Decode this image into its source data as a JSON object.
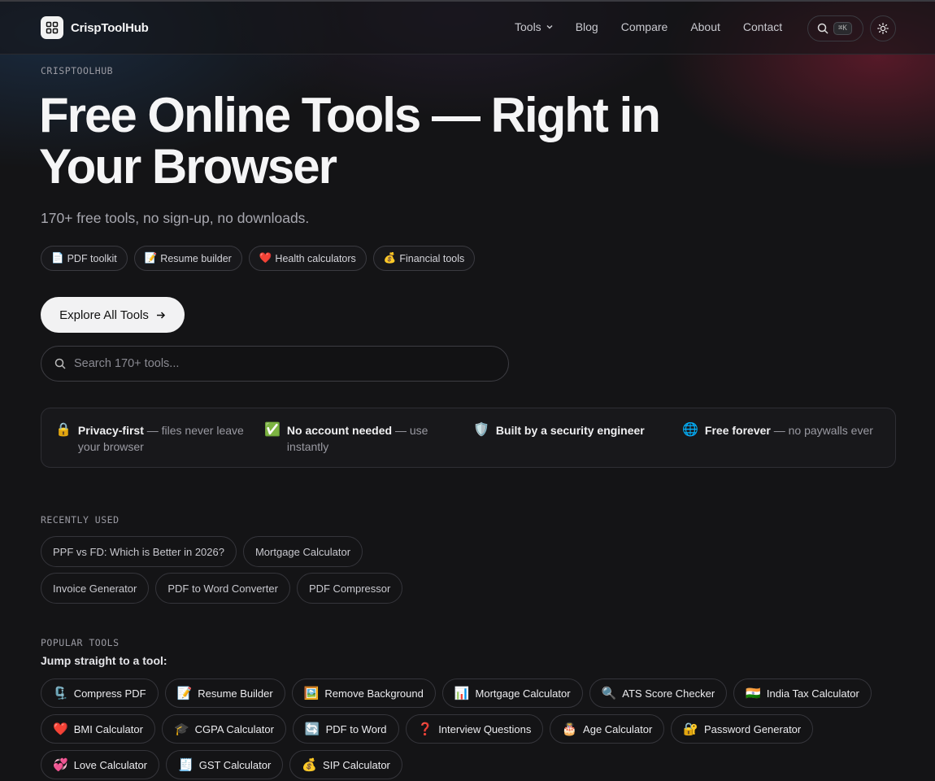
{
  "header": {
    "brand": "CrispToolHub",
    "nav": [
      {
        "label": "Tools",
        "has_dropdown": true
      },
      {
        "label": "Blog"
      },
      {
        "label": "Compare"
      },
      {
        "label": "About"
      },
      {
        "label": "Contact"
      }
    ],
    "search_shortcut": "⌘K"
  },
  "hero": {
    "eyebrow": "CRISPTOOLHUB",
    "title_line1": "Free Online Tools — Right in",
    "title_line2": "Your Browser",
    "subtitle": "170+ free tools, no sign-up, no downloads.",
    "chips": [
      {
        "emoji": "📄",
        "label": "PDF toolkit"
      },
      {
        "emoji": "📝",
        "label": "Resume builder"
      },
      {
        "emoji": "❤️",
        "label": "Health calculators"
      },
      {
        "emoji": "💰",
        "label": "Financial tools"
      }
    ],
    "cta_label": "Explore All Tools",
    "search_placeholder": "Search 170+ tools..."
  },
  "trust": [
    {
      "emoji": "🔒",
      "bold": "Privacy-first",
      "rest": " — files never leave your browser"
    },
    {
      "emoji": "✅",
      "bold": "No account needed",
      "rest": " — use instantly"
    },
    {
      "emoji": "🛡️",
      "bold": "Built by a security engineer",
      "rest": ""
    },
    {
      "emoji": "🌐",
      "bold": "Free forever",
      "rest": " — no paywalls ever"
    }
  ],
  "recently_used": {
    "heading": "RECENTLY USED",
    "items": [
      "PPF vs FD: Which is Better in 2026?",
      "Mortgage Calculator",
      "Invoice Generator",
      "PDF to Word Converter",
      "PDF Compressor"
    ]
  },
  "popular": {
    "heading": "POPULAR TOOLS",
    "subheading": "Jump straight to a tool:",
    "items": [
      {
        "emoji": "🗜️",
        "label": "Compress PDF"
      },
      {
        "emoji": "📝",
        "label": "Resume Builder"
      },
      {
        "emoji": "🖼️",
        "label": "Remove Background"
      },
      {
        "emoji": "📊",
        "label": "Mortgage Calculator"
      },
      {
        "emoji": "🔍",
        "label": "ATS Score Checker"
      },
      {
        "emoji": "🇮🇳",
        "label": "India Tax Calculator"
      },
      {
        "emoji": "❤️",
        "label": "BMI Calculator"
      },
      {
        "emoji": "🎓",
        "label": "CGPA Calculator"
      },
      {
        "emoji": "🔄",
        "label": "PDF to Word"
      },
      {
        "emoji": "❓",
        "label": "Interview Questions"
      },
      {
        "emoji": "🎂",
        "label": "Age Calculator"
      },
      {
        "emoji": "🔐",
        "label": "Password Generator"
      },
      {
        "emoji": "💞",
        "label": "Love Calculator"
      },
      {
        "emoji": "🧾",
        "label": "GST Calculator"
      },
      {
        "emoji": "💰",
        "label": "SIP Calculator"
      }
    ]
  }
}
